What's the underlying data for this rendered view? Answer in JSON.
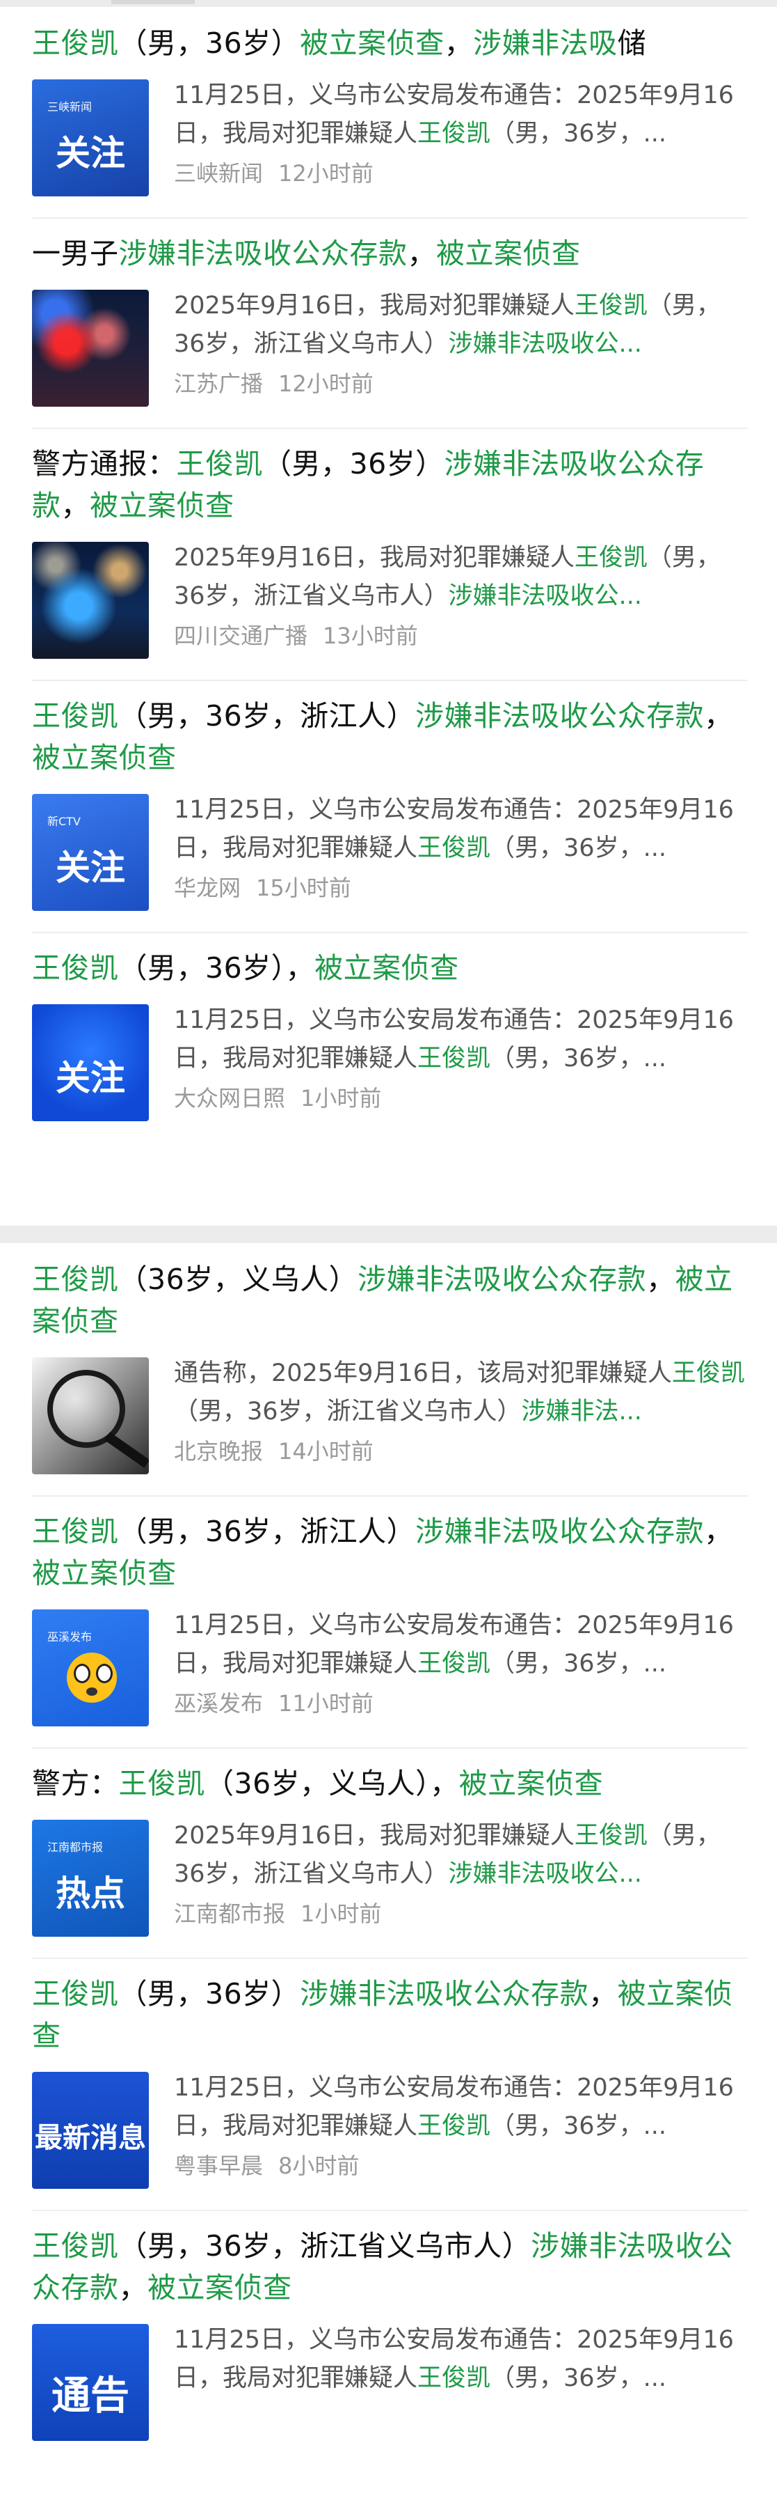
{
  "items": [
    {
      "headline": [
        {
          "t": "王俊凯",
          "c": "g"
        },
        {
          "t": "（男，36岁）",
          "c": "b"
        },
        {
          "t": "被立案侦查",
          "c": "g"
        },
        {
          "t": "，",
          "c": "b"
        },
        {
          "t": "涉嫌非法吸",
          "c": "g"
        },
        {
          "t": "储",
          "c": "b"
        }
      ],
      "thumb": {
        "style": "t-blue",
        "label": "关注",
        "logo": "三峡新闻"
      },
      "summary": [
        {
          "t": "11月25日，义乌市公安局发布通告：2025年9月16日，我局对犯罪嫌疑人",
          "c": ""
        },
        {
          "t": "王俊凯",
          "c": "g"
        },
        {
          "t": "（男，36岁，...",
          "c": ""
        }
      ],
      "source": "三峡新闻",
      "time": "12小时前"
    },
    {
      "headline": [
        {
          "t": "一男子",
          "c": "b"
        },
        {
          "t": "涉嫌非法吸收公众存款",
          "c": "g"
        },
        {
          "t": "，",
          "c": "b"
        },
        {
          "t": "被立案侦查",
          "c": "g"
        }
      ],
      "thumb": {
        "style": "t-police",
        "label": "",
        "logo": ""
      },
      "summary": [
        {
          "t": "2025年9月16日，我局对犯罪嫌疑人",
          "c": ""
        },
        {
          "t": "王俊凯",
          "c": "g"
        },
        {
          "t": "（男，36岁，浙江省义乌市人）",
          "c": ""
        },
        {
          "t": "涉嫌非法吸收公...",
          "c": "g"
        }
      ],
      "source": "江苏广播",
      "time": "12小时前"
    },
    {
      "headline": [
        {
          "t": "警方通报：",
          "c": "b"
        },
        {
          "t": "王俊凯",
          "c": "g"
        },
        {
          "t": "（男，36岁）",
          "c": "b"
        },
        {
          "t": "涉嫌非法吸收公众存款",
          "c": "g"
        },
        {
          "t": "，",
          "c": "b"
        },
        {
          "t": "被立案侦查",
          "c": "g"
        }
      ],
      "thumb": {
        "style": "t-police2",
        "label": "",
        "logo": ""
      },
      "summary": [
        {
          "t": "2025年9月16日，我局对犯罪嫌疑人",
          "c": ""
        },
        {
          "t": "王俊凯",
          "c": "g"
        },
        {
          "t": "（男，36岁，浙江省义乌市人）",
          "c": ""
        },
        {
          "t": "涉嫌非法吸收公...",
          "c": "g"
        }
      ],
      "source": "四川交通广播",
      "time": "13小时前"
    },
    {
      "headline": [
        {
          "t": "王俊凯",
          "c": "g"
        },
        {
          "t": "（男，36岁，浙江人）",
          "c": "b"
        },
        {
          "t": "涉嫌非法吸收公众存款",
          "c": "g"
        },
        {
          "t": "，",
          "c": "b"
        },
        {
          "t": "被立案侦查",
          "c": "g"
        }
      ],
      "thumb": {
        "style": "t-blue2",
        "label": "关注",
        "logo": "新CTV"
      },
      "summary": [
        {
          "t": "11月25日，义乌市公安局发布通告：2025年9月16日，我局对犯罪嫌疑人",
          "c": ""
        },
        {
          "t": "王俊凯",
          "c": "g"
        },
        {
          "t": "（男，36岁，...",
          "c": ""
        }
      ],
      "source": "华龙网",
      "time": "15小时前"
    },
    {
      "headline": [
        {
          "t": "王俊凯",
          "c": "g"
        },
        {
          "t": "（男，36岁），",
          "c": "b"
        },
        {
          "t": "被立案侦查",
          "c": "g"
        }
      ],
      "thumb": {
        "style": "t-blue3",
        "label": "关注",
        "logo": ""
      },
      "summary": [
        {
          "t": "11月25日，义乌市公安局发布通告：2025年9月16日，我局对犯罪嫌疑人",
          "c": ""
        },
        {
          "t": "王俊凯",
          "c": "g"
        },
        {
          "t": "（男，36岁，...",
          "c": ""
        }
      ],
      "source": "大众网日照",
      "time": "1小时前"
    },
    {
      "headline": [
        {
          "t": "王俊凯",
          "c": "g"
        },
        {
          "t": "（36岁，义乌人）",
          "c": "b"
        },
        {
          "t": "涉嫌非法吸收公众存款",
          "c": "g"
        },
        {
          "t": "，",
          "c": "b"
        },
        {
          "t": "被立案侦查",
          "c": "g"
        }
      ],
      "thumb": {
        "style": "t-magnifier",
        "label": "",
        "logo": ""
      },
      "summary": [
        {
          "t": "通告称，2025年9月16日，该局对犯罪嫌疑人",
          "c": ""
        },
        {
          "t": "王俊凯",
          "c": "g"
        },
        {
          "t": "（男，36岁，浙江省义乌市人）",
          "c": ""
        },
        {
          "t": "涉嫌非法...",
          "c": "g"
        }
      ],
      "source": "北京晚报",
      "time": "14小时前"
    },
    {
      "headline": [
        {
          "t": "王俊凯",
          "c": "g"
        },
        {
          "t": "（男，36岁，浙江人）",
          "c": "b"
        },
        {
          "t": "涉嫌非法吸收公众存款",
          "c": "g"
        },
        {
          "t": "，",
          "c": "b"
        },
        {
          "t": "被立案侦查",
          "c": "g"
        }
      ],
      "thumb": {
        "style": "t-emoji",
        "label": "",
        "logo": "巫溪发布"
      },
      "summary": [
        {
          "t": "11月25日，义乌市公安局发布通告：2025年9月16日，我局对犯罪嫌疑人",
          "c": ""
        },
        {
          "t": "王俊凯",
          "c": "g"
        },
        {
          "t": "（男，36岁，...",
          "c": ""
        }
      ],
      "source": "巫溪发布",
      "time": "11小时前"
    },
    {
      "headline": [
        {
          "t": "警方：",
          "c": "b"
        },
        {
          "t": "王俊凯",
          "c": "g"
        },
        {
          "t": "（36岁，义乌人），",
          "c": "b"
        },
        {
          "t": "被立案侦查",
          "c": "g"
        }
      ],
      "thumb": {
        "style": "t-hot",
        "label": "热点",
        "logo": "江南都市报"
      },
      "summary": [
        {
          "t": "2025年9月16日，我局对犯罪嫌疑人",
          "c": ""
        },
        {
          "t": "王俊凯",
          "c": "g"
        },
        {
          "t": "（男，36岁，浙江省义乌市人）",
          "c": ""
        },
        {
          "t": "涉嫌非法吸收公...",
          "c": "g"
        }
      ],
      "source": "江南都市报",
      "time": "1小时前"
    },
    {
      "headline": [
        {
          "t": "王俊凯",
          "c": "g"
        },
        {
          "t": "（男，36岁）",
          "c": "b"
        },
        {
          "t": "涉嫌非法吸收公众存款",
          "c": "g"
        },
        {
          "t": "，",
          "c": "b"
        },
        {
          "t": "被立案侦查",
          "c": "g"
        }
      ],
      "thumb": {
        "style": "t-breaking",
        "label": "最新消息",
        "logo": ""
      },
      "summary": [
        {
          "t": "11月25日，义乌市公安局发布通告：2025年9月16日，我局对犯罪嫌疑人",
          "c": ""
        },
        {
          "t": "王俊凯",
          "c": "g"
        },
        {
          "t": "（男，36岁，...",
          "c": ""
        }
      ],
      "source": "粤事早晨",
      "time": "8小时前"
    },
    {
      "headline": [
        {
          "t": "王俊凯",
          "c": "g"
        },
        {
          "t": "（男，36岁，浙江省义乌市人）",
          "c": "b"
        },
        {
          "t": "涉嫌非法吸收公众存款",
          "c": "g"
        },
        {
          "t": "，",
          "c": "b"
        },
        {
          "t": "被立案侦查",
          "c": "g"
        }
      ],
      "thumb": {
        "style": "t-notice",
        "label": "通告",
        "logo": ""
      },
      "summary": [
        {
          "t": "11月25日，义乌市公安局发布通告：2025年9月16日，我局对犯罪嫌疑人",
          "c": ""
        },
        {
          "t": "王俊凯",
          "c": "g"
        },
        {
          "t": "（男，36岁，...",
          "c": ""
        }
      ],
      "source": "",
      "time": ""
    }
  ],
  "colors": {
    "highlight": "#1f9a47",
    "text": "#111111",
    "summary": "#555555",
    "meta": "#9a9a9a"
  }
}
